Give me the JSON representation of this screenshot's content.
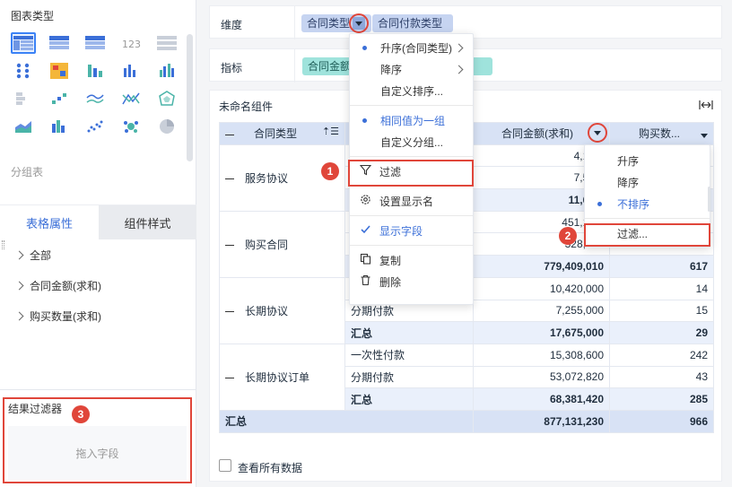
{
  "left": {
    "chart_type_title": "图表类型",
    "group_label": "分组表",
    "icons": [
      "table-group-icon",
      "table-cross-icon",
      "table-detail-icon",
      "number-card-icon",
      "table-freeze-icon",
      "dot-matrix-icon",
      "heatmap-icon",
      "bar-stacked-icon",
      "bar-chart-icon",
      "bar-grouped-icon",
      "block-icon",
      "step-bar-icon",
      "line-multi-icon",
      "line-cross-icon",
      "radar-icon",
      "area-chart-icon",
      "bar-cluster-icon",
      "scatter-icon",
      "bubble-cluster-icon",
      "pie-chart-icon"
    ],
    "number_card_text": "123",
    "tabs": [
      "表格属性",
      "组件样式"
    ],
    "props": [
      "全部",
      "合同金额(求和)",
      "购买数量(求和)"
    ],
    "filter_title": "结果过滤器",
    "filter_placeholder": "拖入字段"
  },
  "fields": {
    "dimension_label": "维度",
    "dimension_pills": [
      "合同类型",
      "合同付款类型"
    ],
    "metric_label": "指标",
    "metric_pills": [
      "合同金额"
    ]
  },
  "widget": {
    "title": "未命名组件",
    "headers": [
      "合同类型",
      "合同金额(求和)",
      "购买数..."
    ],
    "rows": [
      {
        "group": "服务协议",
        "sub": [
          "",
          "",
          "汇总"
        ],
        "amount": [
          "4,155,",
          "7,510,",
          "11,665,"
        ],
        "qty": [
          "",
          "",
          ""
        ]
      },
      {
        "group": "购买合同",
        "sub": [
          "",
          "",
          ""
        ],
        "amount": [
          "451,142,",
          "328,267",
          "779,409,010"
        ],
        "qty": [
          "",
          "",
          "617"
        ]
      },
      {
        "group": "长期协议",
        "sub": [
          "",
          "分期付款",
          "汇总"
        ],
        "amount": [
          "10,420,000",
          "7,255,000",
          "17,675,000"
        ],
        "qty": [
          "14",
          "15",
          "29"
        ]
      },
      {
        "group": "长期协议订单",
        "sub": [
          "一次性付款",
          "分期付款",
          "汇总"
        ],
        "amount": [
          "15,308,600",
          "53,072,820",
          "68,381,420"
        ],
        "qty": [
          "242",
          "43",
          "285"
        ]
      }
    ],
    "total": {
      "label": "汇总",
      "amount": "877,131,230",
      "qty": "966"
    },
    "show_all_label": "查看所有数据"
  },
  "menu1": {
    "items": [
      {
        "label": "升序(合同类型)",
        "dot": true,
        "arrow": true
      },
      {
        "label": "降序",
        "dot": false,
        "arrow": true
      },
      {
        "label": "自定义排序...",
        "dot": false,
        "arrow": false
      },
      {
        "label": "相同值为一组",
        "dot": true,
        "arrow": false,
        "blue": true
      },
      {
        "label": "自定义分组...",
        "dot": false,
        "arrow": false
      },
      {
        "label": "过滤",
        "icon": "filter-icon"
      },
      {
        "label": "设置显示名",
        "icon": "gear-icon"
      },
      {
        "label": "显示字段",
        "icon": "check-icon",
        "blue": true
      },
      {
        "label": "复制",
        "icon": "copy-icon"
      },
      {
        "label": "删除",
        "icon": "trash-icon"
      }
    ]
  },
  "menu2": {
    "items": [
      {
        "label": "升序",
        "dot": false
      },
      {
        "label": "降序",
        "dot": false
      },
      {
        "label": "不排序",
        "dot": true,
        "blue": true
      },
      {
        "label": "过滤...",
        "dot": false
      }
    ]
  },
  "badges": [
    "1",
    "2",
    "3"
  ],
  "colors": {
    "accent": "#3b6fd8",
    "highlight": "#e0463a",
    "header_bg": "#d8e2f5"
  }
}
